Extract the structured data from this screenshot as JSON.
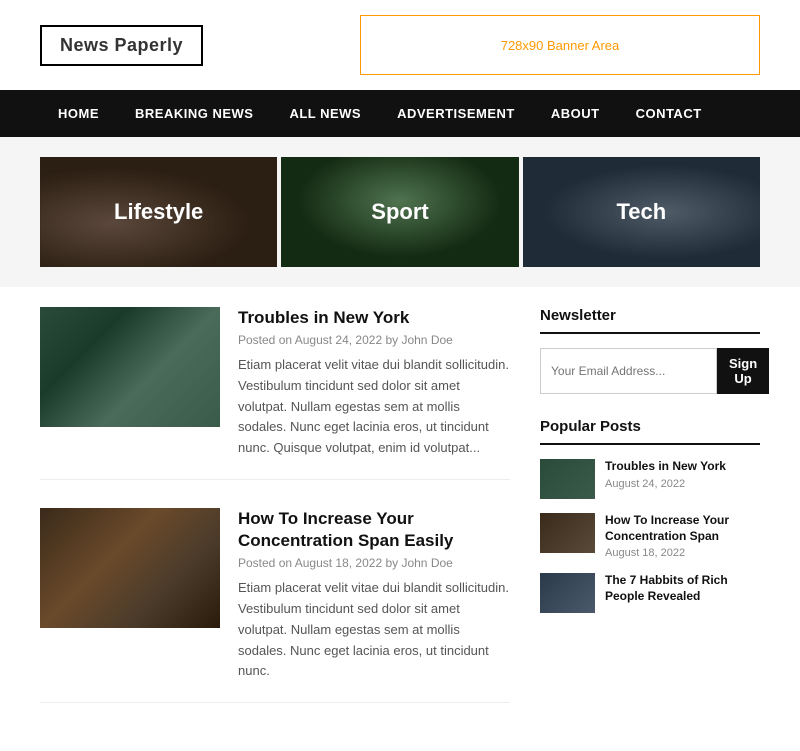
{
  "header": {
    "logo": "News Paperly",
    "banner_text": "728x90 Banner Area"
  },
  "nav": {
    "items": [
      {
        "label": "HOME",
        "active": true
      },
      {
        "label": "BREAKING NEWS"
      },
      {
        "label": "ALL NEWS"
      },
      {
        "label": "ADVERTISEMENT"
      },
      {
        "label": "ABOUT"
      },
      {
        "label": "CONTACT"
      }
    ]
  },
  "categories": [
    {
      "label": "Lifestyle"
    },
    {
      "label": "Sport"
    },
    {
      "label": "Tech"
    }
  ],
  "articles": [
    {
      "title": "Troubles in New York",
      "meta": "Posted on August 24, 2022 by John Doe",
      "excerpt": "Etiam placerat velit vitae dui blandit sollicitudin. Vestibulum tincidunt sed dolor sit amet volutpat. Nullam egestas sem at mollis sodales. Nunc eget lacinia eros, ut tincidunt nunc. Quisque volutpat, enim id volutpat..."
    },
    {
      "title": "How To Increase Your Concentration Span Easily",
      "meta": "Posted on August 18, 2022 by John Doe",
      "excerpt": "Etiam placerat velit vitae dui blandit sollicitudin. Vestibulum tincidunt sed dolor sit amet volutpat. Nullam egestas sem at mollis sodales. Nunc eget lacinia eros, ut tincidunt nunc."
    }
  ],
  "sidebar": {
    "newsletter": {
      "title": "Newsletter",
      "placeholder": "Your Email Address...",
      "button_label": "Sign Up"
    },
    "popular_posts": {
      "title": "Popular Posts",
      "items": [
        {
          "title": "Troubles in New York",
          "date": "August 24, 2022"
        },
        {
          "title": "How To Increase Your Concentration Span",
          "date": "August 18, 2022"
        },
        {
          "title": "The 7 Habbits of Rich People Revealed",
          "date": ""
        }
      ]
    }
  }
}
